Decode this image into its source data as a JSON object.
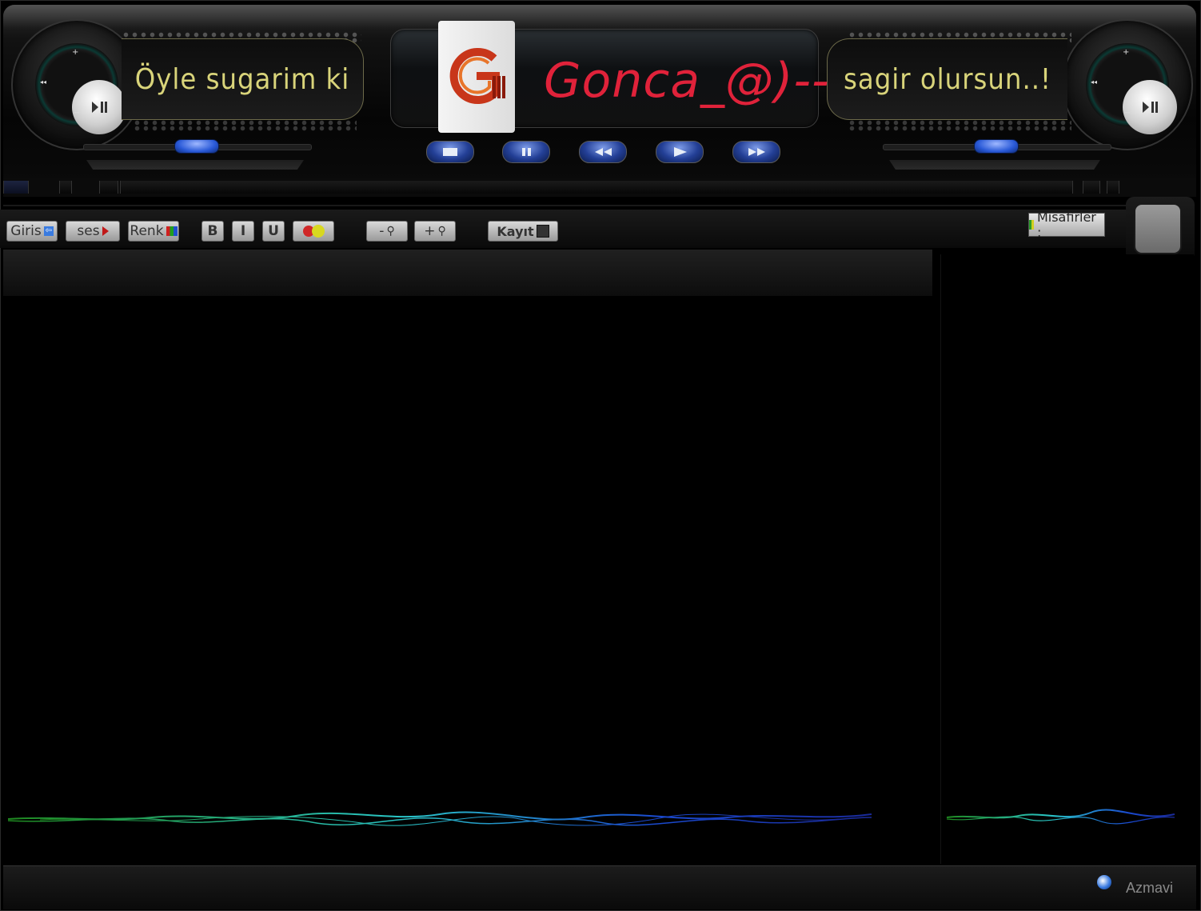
{
  "player": {
    "lyric_left": "Öyle sugarim ki",
    "lyric_right": "sagir olursun..!",
    "room_title": "Gonca_@)--",
    "logo_letter": "G",
    "transport": [
      "stop",
      "pause",
      "rewind",
      "play",
      "fast-forward"
    ]
  },
  "toolbar": {
    "giris_label": "Giris",
    "ses_label": "ses",
    "renk_label": "Renk",
    "bold_label": "B",
    "italic_label": "I",
    "underline_label": "U",
    "zoom_out_label": "-",
    "zoom_in_label": "+",
    "kayit_label": "Kayıt"
  },
  "userlist": {
    "header_label": "Misafirler :"
  },
  "footer": {
    "brand": "Azmavi"
  },
  "colors": {
    "lyric": "#d9d47a",
    "title": "#e0223a",
    "accent_blue": "#2a5ad8"
  }
}
